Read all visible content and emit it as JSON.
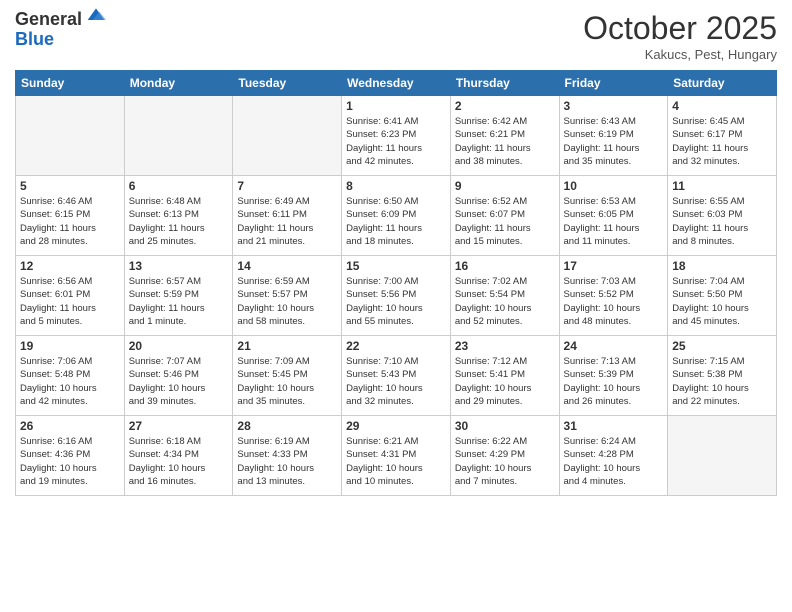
{
  "logo": {
    "general": "General",
    "blue": "Blue"
  },
  "header": {
    "month": "October 2025",
    "location": "Kakucs, Pest, Hungary"
  },
  "weekdays": [
    "Sunday",
    "Monday",
    "Tuesday",
    "Wednesday",
    "Thursday",
    "Friday",
    "Saturday"
  ],
  "weeks": [
    [
      {
        "day": "",
        "info": ""
      },
      {
        "day": "",
        "info": ""
      },
      {
        "day": "",
        "info": ""
      },
      {
        "day": "1",
        "info": "Sunrise: 6:41 AM\nSunset: 6:23 PM\nDaylight: 11 hours\nand 42 minutes."
      },
      {
        "day": "2",
        "info": "Sunrise: 6:42 AM\nSunset: 6:21 PM\nDaylight: 11 hours\nand 38 minutes."
      },
      {
        "day": "3",
        "info": "Sunrise: 6:43 AM\nSunset: 6:19 PM\nDaylight: 11 hours\nand 35 minutes."
      },
      {
        "day": "4",
        "info": "Sunrise: 6:45 AM\nSunset: 6:17 PM\nDaylight: 11 hours\nand 32 minutes."
      }
    ],
    [
      {
        "day": "5",
        "info": "Sunrise: 6:46 AM\nSunset: 6:15 PM\nDaylight: 11 hours\nand 28 minutes."
      },
      {
        "day": "6",
        "info": "Sunrise: 6:48 AM\nSunset: 6:13 PM\nDaylight: 11 hours\nand 25 minutes."
      },
      {
        "day": "7",
        "info": "Sunrise: 6:49 AM\nSunset: 6:11 PM\nDaylight: 11 hours\nand 21 minutes."
      },
      {
        "day": "8",
        "info": "Sunrise: 6:50 AM\nSunset: 6:09 PM\nDaylight: 11 hours\nand 18 minutes."
      },
      {
        "day": "9",
        "info": "Sunrise: 6:52 AM\nSunset: 6:07 PM\nDaylight: 11 hours\nand 15 minutes."
      },
      {
        "day": "10",
        "info": "Sunrise: 6:53 AM\nSunset: 6:05 PM\nDaylight: 11 hours\nand 11 minutes."
      },
      {
        "day": "11",
        "info": "Sunrise: 6:55 AM\nSunset: 6:03 PM\nDaylight: 11 hours\nand 8 minutes."
      }
    ],
    [
      {
        "day": "12",
        "info": "Sunrise: 6:56 AM\nSunset: 6:01 PM\nDaylight: 11 hours\nand 5 minutes."
      },
      {
        "day": "13",
        "info": "Sunrise: 6:57 AM\nSunset: 5:59 PM\nDaylight: 11 hours\nand 1 minute."
      },
      {
        "day": "14",
        "info": "Sunrise: 6:59 AM\nSunset: 5:57 PM\nDaylight: 10 hours\nand 58 minutes."
      },
      {
        "day": "15",
        "info": "Sunrise: 7:00 AM\nSunset: 5:56 PM\nDaylight: 10 hours\nand 55 minutes."
      },
      {
        "day": "16",
        "info": "Sunrise: 7:02 AM\nSunset: 5:54 PM\nDaylight: 10 hours\nand 52 minutes."
      },
      {
        "day": "17",
        "info": "Sunrise: 7:03 AM\nSunset: 5:52 PM\nDaylight: 10 hours\nand 48 minutes."
      },
      {
        "day": "18",
        "info": "Sunrise: 7:04 AM\nSunset: 5:50 PM\nDaylight: 10 hours\nand 45 minutes."
      }
    ],
    [
      {
        "day": "19",
        "info": "Sunrise: 7:06 AM\nSunset: 5:48 PM\nDaylight: 10 hours\nand 42 minutes."
      },
      {
        "day": "20",
        "info": "Sunrise: 7:07 AM\nSunset: 5:46 PM\nDaylight: 10 hours\nand 39 minutes."
      },
      {
        "day": "21",
        "info": "Sunrise: 7:09 AM\nSunset: 5:45 PM\nDaylight: 10 hours\nand 35 minutes."
      },
      {
        "day": "22",
        "info": "Sunrise: 7:10 AM\nSunset: 5:43 PM\nDaylight: 10 hours\nand 32 minutes."
      },
      {
        "day": "23",
        "info": "Sunrise: 7:12 AM\nSunset: 5:41 PM\nDaylight: 10 hours\nand 29 minutes."
      },
      {
        "day": "24",
        "info": "Sunrise: 7:13 AM\nSunset: 5:39 PM\nDaylight: 10 hours\nand 26 minutes."
      },
      {
        "day": "25",
        "info": "Sunrise: 7:15 AM\nSunset: 5:38 PM\nDaylight: 10 hours\nand 22 minutes."
      }
    ],
    [
      {
        "day": "26",
        "info": "Sunrise: 6:16 AM\nSunset: 4:36 PM\nDaylight: 10 hours\nand 19 minutes."
      },
      {
        "day": "27",
        "info": "Sunrise: 6:18 AM\nSunset: 4:34 PM\nDaylight: 10 hours\nand 16 minutes."
      },
      {
        "day": "28",
        "info": "Sunrise: 6:19 AM\nSunset: 4:33 PM\nDaylight: 10 hours\nand 13 minutes."
      },
      {
        "day": "29",
        "info": "Sunrise: 6:21 AM\nSunset: 4:31 PM\nDaylight: 10 hours\nand 10 minutes."
      },
      {
        "day": "30",
        "info": "Sunrise: 6:22 AM\nSunset: 4:29 PM\nDaylight: 10 hours\nand 7 minutes."
      },
      {
        "day": "31",
        "info": "Sunrise: 6:24 AM\nSunset: 4:28 PM\nDaylight: 10 hours\nand 4 minutes."
      },
      {
        "day": "",
        "info": ""
      }
    ]
  ]
}
